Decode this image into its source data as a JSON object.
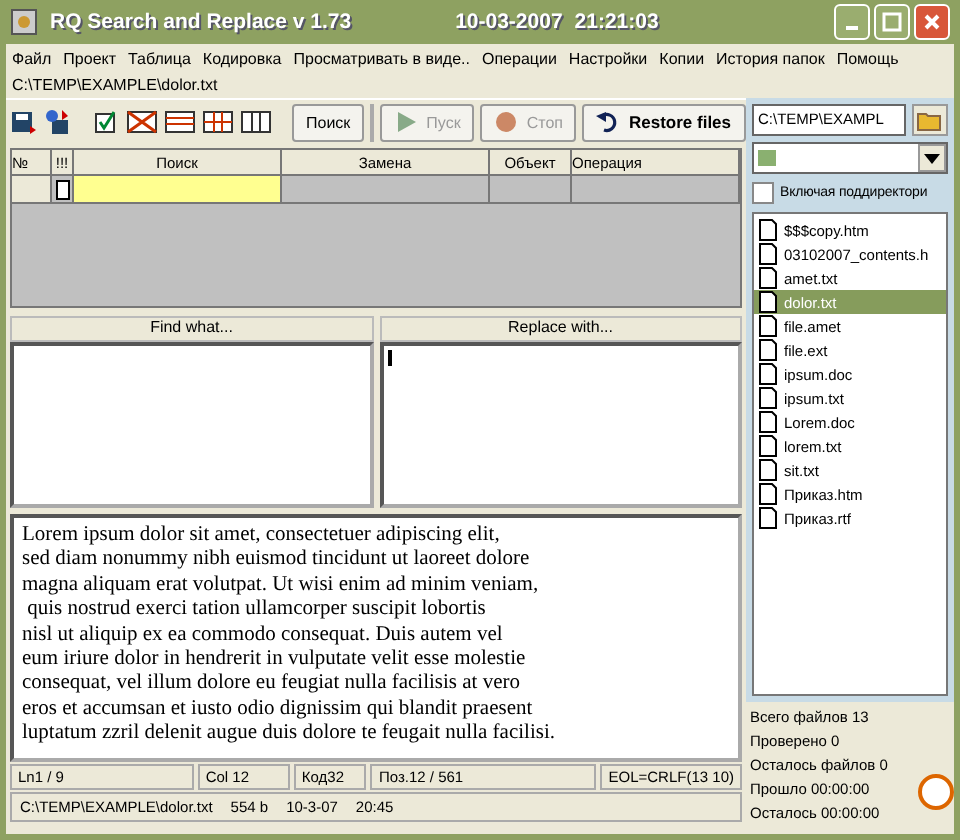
{
  "window": {
    "title": "RQ Search and Replace v 1.73",
    "date": "10-03-2007",
    "time": "21:21:03"
  },
  "menu": [
    "Файл",
    "Проект",
    "Таблица",
    "Кодировка",
    "Просматривать в виде..",
    "Операции",
    "Настройки",
    "Копии",
    "История папок",
    "Помощь"
  ],
  "path": "C:\\TEMP\\EXAMPLE\\dolor.txt",
  "toolbar": [
    {
      "label": "Поиск",
      "kind": "plain",
      "disabled": false
    },
    {
      "label": "Пуск",
      "kind": "play",
      "disabled": true
    },
    {
      "label": "Стоп",
      "kind": "stop",
      "disabled": true
    },
    {
      "label": "Restore files",
      "kind": "restore",
      "disabled": false
    }
  ],
  "grid": {
    "columns": [
      "№",
      "!!!",
      "Поиск",
      "Замена",
      "Объект",
      "Операция"
    ]
  },
  "find_label": "Find what...",
  "replace_label": "Replace with...",
  "editor_lines": [
    "Lorem ipsum dolor sit amet, consectetuer adipiscing elit,",
    "sed diam nonummy nibh euismod tincidunt ut laoreet dolore",
    "magna aliquam erat volutpat. Ut wisi enim ad minim veniam,",
    " quis nostrud exerci tation ullamcorper suscipit lobortis",
    "nisl ut aliquip ex ea commodo consequat. Duis autem vel",
    "eum iriure dolor in hendrerit in vulputate velit esse molestie",
    "consequat, vel illum dolore eu feugiat nulla facilisis at vero",
    "eros et accumsan et iusto odio dignissim qui blandit praesent",
    "luptatum zzril delenit augue duis dolore te feugait nulla facilisi."
  ],
  "status": [
    "Ln1 / 9",
    "Col 12",
    "Код32",
    "Поз.12 / 561",
    "EOL=CRLF(13 10)"
  ],
  "file_info": [
    "C:\\TEMP\\EXAMPLE\\dolor.txt",
    "554 b",
    "10-3-07",
    "20:45"
  ],
  "sidebar": {
    "folder": "C:\\TEMP\\EXAMPL",
    "subdirs": {
      "label": "Включая поддиректори",
      "checked": false
    },
    "files": [
      {
        "name": "$$$copy.htm",
        "selected": false
      },
      {
        "name": "03102007_contents.h",
        "selected": false
      },
      {
        "name": "amet.txt",
        "selected": false
      },
      {
        "name": "dolor.txt",
        "selected": true
      },
      {
        "name": "file.amet",
        "selected": false
      },
      {
        "name": "file.ext",
        "selected": false
      },
      {
        "name": "ipsum.doc",
        "selected": false
      },
      {
        "name": "ipsum.txt",
        "selected": false
      },
      {
        "name": "Lorem.doc",
        "selected": false
      },
      {
        "name": "lorem.txt",
        "selected": false
      },
      {
        "name": "sit.txt",
        "selected": false
      },
      {
        "name": "Приказ.htm",
        "selected": false
      },
      {
        "name": "Приказ.rtf",
        "selected": false
      }
    ],
    "stats": [
      "Всего файлов 13",
      "Проверено 0",
      "Осталось файлов 0",
      "Прошло 00:00:00",
      "Осталось 00:00:00"
    ]
  }
}
